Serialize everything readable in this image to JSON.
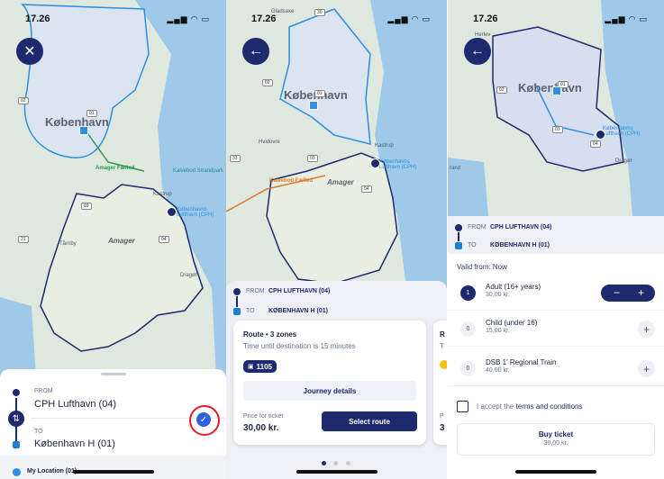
{
  "status_bar": {
    "time": "17.26",
    "icons": "signal-wifi-battery"
  },
  "screen1": {
    "map": {
      "city_label": "København",
      "labels": [
        "Amager Fælled",
        "Kalvebod Strandpark",
        "Kastrup",
        "Amager",
        "Tårnby",
        "Dragør",
        "Københavns Lufthavn (CPH)"
      ],
      "zones": [
        "02",
        "01",
        "03",
        "04",
        "21"
      ]
    },
    "from_label": "FROM",
    "from_value": "CPH Lufthavn (04)",
    "to_label": "TO",
    "to_value": "København H (01)",
    "my_location": "My Location (01)"
  },
  "screen2": {
    "map": {
      "city_label": "København",
      "labels": [
        "Gladsaxe",
        "Hvidovre",
        "Kastrup",
        "Københavns Lufthavn (CPH)",
        "Kalvebod Fælled",
        "Amager"
      ],
      "zones": [
        "02",
        "01",
        "33",
        "03",
        "04",
        "30"
      ]
    },
    "from_label": "FROM",
    "from_value": "CPH LUFTHAVN (04)",
    "to_label": "TO",
    "to_value": "KØBENHAVN H (01)",
    "route_title": "Route • 3 zones",
    "route_time": "Time until destination is 15 minutes",
    "train_number": "1105",
    "journey_details": "Journey details",
    "price_label": "Price for ticket",
    "price_value": "30,00 kr.",
    "select_route": "Select route",
    "peek": {
      "r": "R",
      "t": "T",
      "p": "P",
      "three": "3"
    }
  },
  "screen3": {
    "map": {
      "city_label": "København",
      "labels": [
        "Herlev",
        "Dragør",
        "Københavns Lufthavn (CPH)",
        "rand"
      ],
      "zones": [
        "01",
        "02",
        "03",
        "04"
      ]
    },
    "from_label": "FROM",
    "from_value": "CPH LUFTHAVN (04)",
    "to_label": "TO",
    "to_value": "KØBENHAVN H (01)",
    "valid_from": "Valid from: Now",
    "tickets": [
      {
        "qty": "1",
        "name": "Adult (16+ years)",
        "price": "30,00 kr."
      },
      {
        "qty": "0",
        "name": "Child (under 16)",
        "price": "15,00 kr."
      },
      {
        "qty": "0",
        "name": "DSB 1' Regional Train",
        "price": "40,00 kr."
      }
    ],
    "minus": "−",
    "plus": "+",
    "accept_prefix": "I accept the ",
    "accept_link": "terms and conditions",
    "buy_ticket": "Buy ticket",
    "buy_price": "30,00 kr."
  },
  "colors": {
    "navy": "#1e2a6e",
    "blue": "#1e7fd6",
    "route_blue": "#2f8fe0",
    "highlight_red": "#e01e2b",
    "amager_green": "#2a9a4a",
    "orange": "#e07a2a"
  }
}
